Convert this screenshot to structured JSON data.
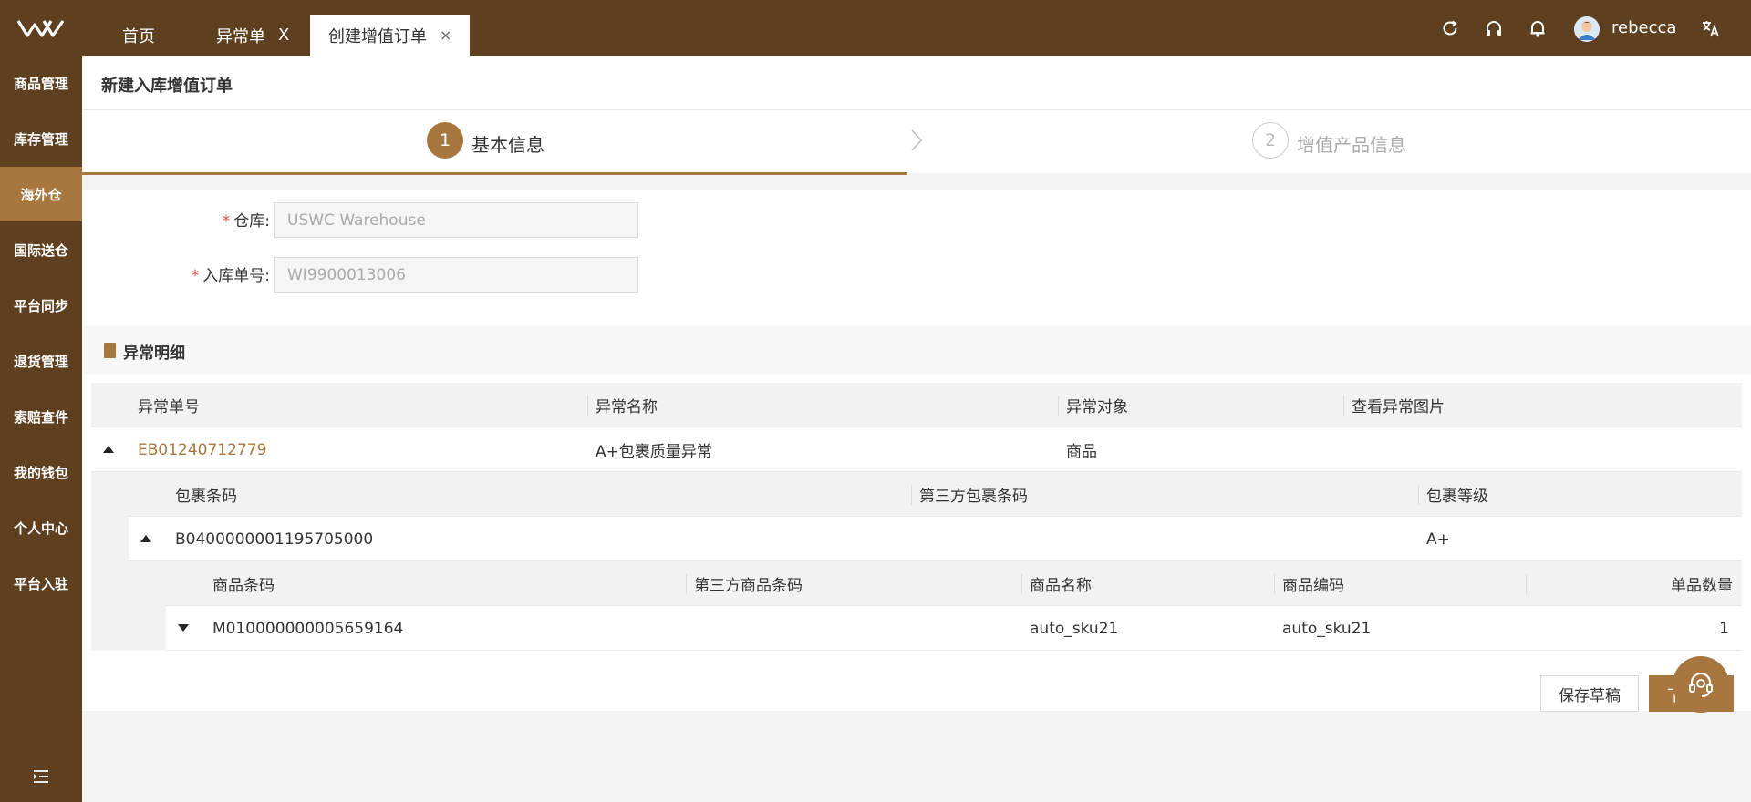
{
  "topbar": {
    "tabs": [
      {
        "label": "首页"
      },
      {
        "label": "异常单",
        "close": "X"
      },
      {
        "label": "创建增值订单",
        "close": "×"
      }
    ],
    "username": "rebecca"
  },
  "sidebar": {
    "items": [
      {
        "label": "商品管理"
      },
      {
        "label": "库存管理"
      },
      {
        "label": "海外仓"
      },
      {
        "label": "国际送仓"
      },
      {
        "label": "平台同步"
      },
      {
        "label": "退货管理"
      },
      {
        "label": "索赔查件"
      },
      {
        "label": "我的钱包"
      },
      {
        "label": "个人中心"
      },
      {
        "label": "平台入驻"
      }
    ],
    "active_index": 2
  },
  "page": {
    "title": "新建入库增值订单"
  },
  "steps": [
    {
      "num": "1",
      "label": "基本信息"
    },
    {
      "num": "2",
      "label": "增值产品信息"
    }
  ],
  "form": {
    "warehouse": {
      "required": "*",
      "label": "仓库:",
      "value": "USWC Warehouse"
    },
    "inbound_no": {
      "required": "*",
      "label": "入库单号:",
      "value": "WI9900013006"
    }
  },
  "section": {
    "title": "异常明细"
  },
  "exception_table": {
    "headers": [
      "异常单号",
      "异常名称",
      "异常对象",
      "查看异常图片"
    ],
    "row": {
      "no": "EB01240712779",
      "name": "A+包裹质量异常",
      "object": "商品"
    }
  },
  "package_table": {
    "headers": [
      "包裹条码",
      "第三方包裹条码",
      "包裹等级"
    ],
    "row": {
      "barcode": "B0400000001195705000",
      "grade": "A+"
    }
  },
  "product_table": {
    "headers": [
      "商品条码",
      "第三方商品条码",
      "商品名称",
      "商品编码",
      "单品数量"
    ],
    "row": {
      "barcode": "M010000000005659164",
      "name": "auto_sku21",
      "code": "auto_sku21",
      "qty": "1"
    }
  },
  "actions": {
    "save_draft": "保存草稿",
    "next": "下"
  },
  "colors": {
    "brand_dark": "#5e3f1f",
    "accent": "#a7773f",
    "required": "#e64b3c"
  }
}
